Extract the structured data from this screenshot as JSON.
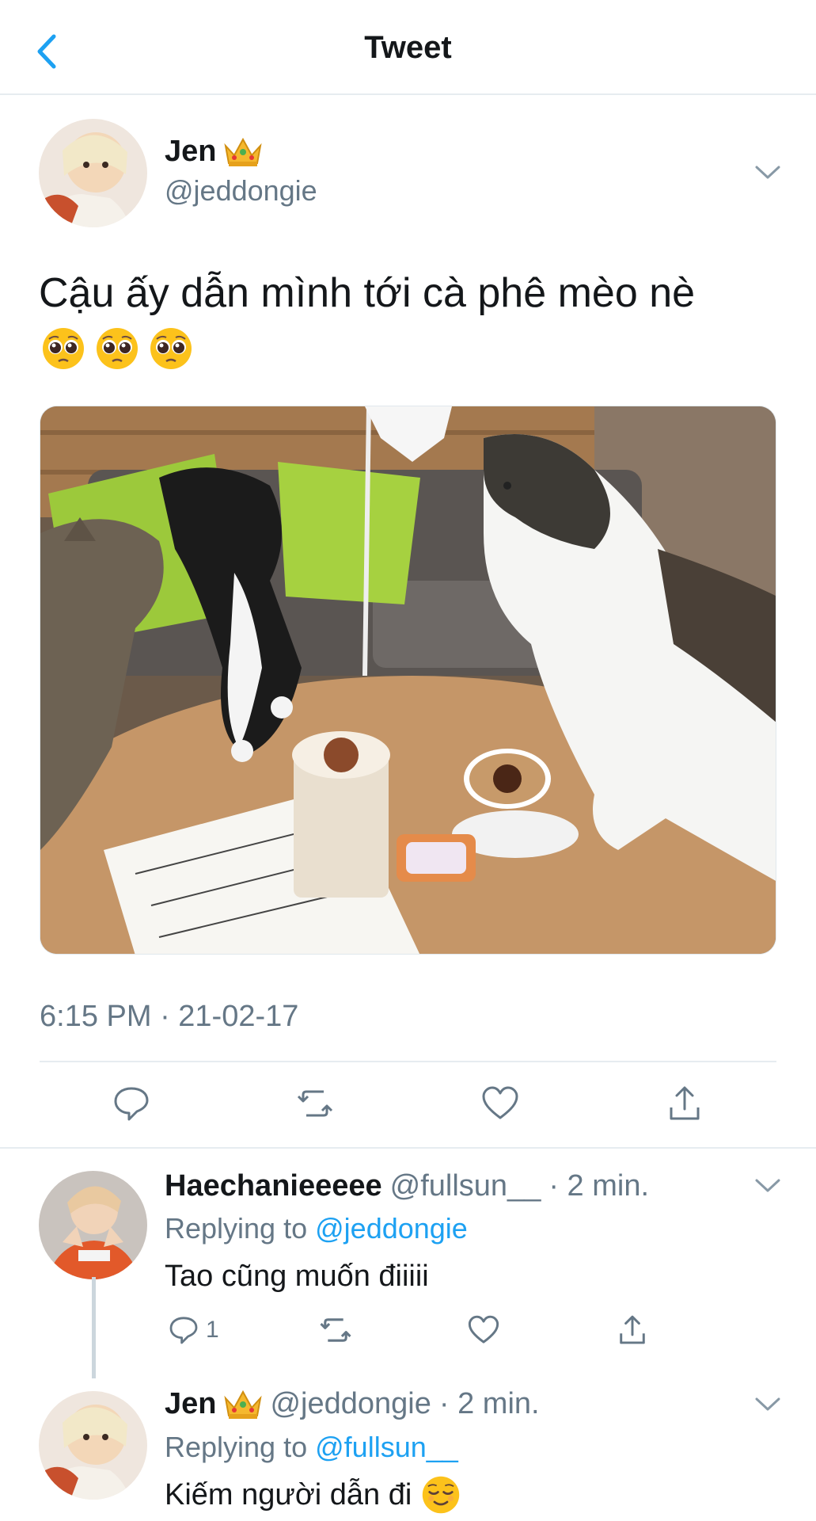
{
  "header": {
    "title": "Tweet"
  },
  "tweet": {
    "author_name": "Jen",
    "author_badge": "crown",
    "handle": "@jeddongie",
    "text": "Cậu ấy dẫn mình tới cà phê mèo nè",
    "emoji": "pleading-face",
    "emoji_count": 3,
    "timestamp": "6:15 PM · 21-02-17",
    "actions": [
      "reply",
      "retweet",
      "like",
      "share"
    ]
  },
  "replies": [
    {
      "name": "Haechanieeeee",
      "handle": "@fullsun__",
      "time": "· 2 min.",
      "replying_label": "Replying to",
      "replying_to": "@jeddongie",
      "text": "Tao cũng muốn điiiii",
      "reply_count": "1"
    },
    {
      "name": "Jen",
      "badge": "crown",
      "handle": "@jeddongie",
      "time": "· 2 min.",
      "replying_label": "Replying to",
      "replying_to": "@fullsun__",
      "text": "Kiếm người dẫn đi",
      "emoji": "relieved-face"
    }
  ],
  "colors": {
    "accent": "#1da1f2",
    "muted": "#657786",
    "text": "#14171a",
    "divider": "#e6ecf0"
  }
}
